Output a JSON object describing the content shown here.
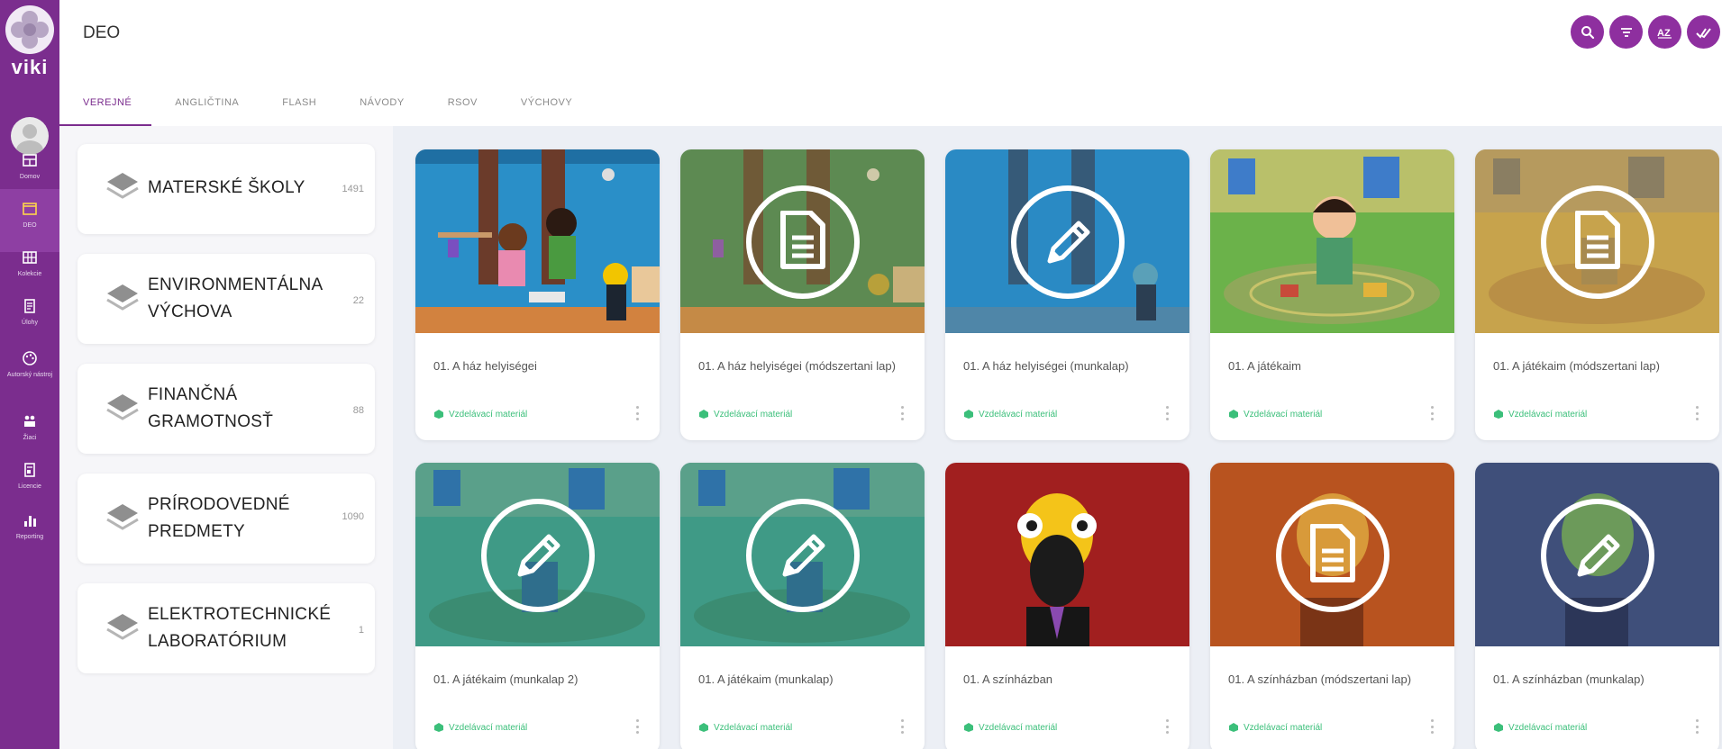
{
  "app": {
    "title": "DEO",
    "brand": "viki"
  },
  "colors": {
    "accent": "#7b2d8e",
    "header_button": "#8e2f9f",
    "tag": "#3bbf7a"
  },
  "rail": {
    "items": [
      {
        "label": "Domov",
        "icon": "dashboard-icon"
      },
      {
        "label": "DEO",
        "icon": "window-icon",
        "active": true
      },
      {
        "label": "Kolekcie",
        "icon": "grid-icon"
      },
      {
        "label": "Úlohy",
        "icon": "clipboard-icon"
      },
      {
        "label": "Autorský nástroj",
        "icon": "palette-icon"
      },
      {
        "label": "Žiaci",
        "icon": "students-icon"
      },
      {
        "label": "Licencie",
        "icon": "license-icon"
      },
      {
        "label": "Reporting",
        "icon": "bar-chart-icon"
      }
    ]
  },
  "header_actions": [
    "search-icon",
    "filter-icon",
    "sort-az-icon",
    "check-all-icon"
  ],
  "tabs": [
    {
      "label": "VEREJNÉ",
      "active": true
    },
    {
      "label": "ANGLIČTINA"
    },
    {
      "label": "FLASH"
    },
    {
      "label": "NÁVODY"
    },
    {
      "label": "RSOV"
    },
    {
      "label": "VÝCHOVY"
    }
  ],
  "categories": [
    {
      "line1": "MATERSKÉ ŠKOLY",
      "line2": "",
      "count": "1491"
    },
    {
      "line1": "ENVIRONMENTÁLNA",
      "line2": "VÝCHOVA",
      "count": "22"
    },
    {
      "line1": "FINANČNÁ",
      "line2": "GRAMOTNOSŤ",
      "count": "88"
    },
    {
      "line1": "PRÍRODOVEDNÉ",
      "line2": "PREDMETY",
      "count": "1090"
    },
    {
      "line1": "ELEKTROTECHNICKÉ",
      "line2": "LABORATÓRIUM",
      "count": "1"
    }
  ],
  "cards": [
    {
      "title": "01. A ház helyiségei",
      "tag": "Vzdelávací materiál",
      "scene": "room",
      "overlay": "none"
    },
    {
      "title": "01. A ház helyiségei (módszertani lap)",
      "tag": "Vzdelávací materiál",
      "scene": "room-green",
      "overlay": "document-icon"
    },
    {
      "title": "01. A ház helyiségei (munkalap)",
      "tag": "Vzdelávací materiál",
      "scene": "room",
      "overlay": "pencil-icon"
    },
    {
      "title": "01. A játékaim",
      "tag": "Vzdelávací materiál",
      "scene": "playroom",
      "overlay": "none"
    },
    {
      "title": "01. A játékaim (módszertani lap)",
      "tag": "Vzdelávací materiál",
      "scene": "playroom-warm",
      "overlay": "document-icon"
    },
    {
      "title": "01. A játékaim (munkalap 2)",
      "tag": "Vzdelávací materiál",
      "scene": "playroom-teal",
      "overlay": "pencil-icon"
    },
    {
      "title": "01. A játékaim (munkalap)",
      "tag": "Vzdelávací materiál",
      "scene": "playroom-teal",
      "overlay": "pencil-icon"
    },
    {
      "title": "01. A színházban",
      "tag": "Vzdelávací materiál",
      "scene": "theater-red",
      "overlay": "none"
    },
    {
      "title": "01. A színházban (módszertani lap)",
      "tag": "Vzdelávací materiál",
      "scene": "theater-orange",
      "overlay": "document-icon"
    },
    {
      "title": "01. A színházban (munkalap)",
      "tag": "Vzdelávací materiál",
      "scene": "theater-blue",
      "overlay": "pencil-icon"
    }
  ]
}
